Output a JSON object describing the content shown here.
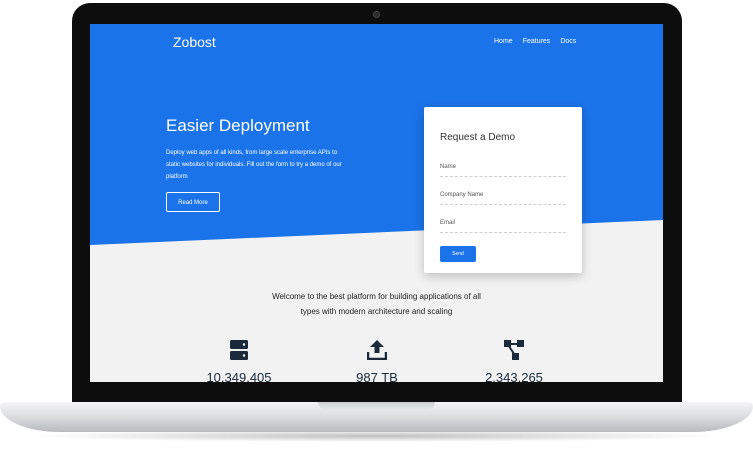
{
  "site": {
    "brand": "Zobost",
    "nav": [
      "Home",
      "Features",
      "Docs"
    ]
  },
  "hero": {
    "title": "Easier Deployment",
    "text": "Deploy web apps of all kinds, from large scale enterprise APIs to static websites for individuals. Fill out the form to try a demo of our platform",
    "button": "Read More"
  },
  "demo_form": {
    "title": "Request a Demo",
    "fields": [
      "Name",
      "Company Name",
      "Email"
    ],
    "submit": "Send"
  },
  "welcome": {
    "line1": "Welcome to the best platform for building applications of all",
    "line2": "types with modern architecture and scaling"
  },
  "stats": [
    {
      "value": "10,349,405",
      "icon": "server-icon"
    },
    {
      "value": "987 TB",
      "icon": "upload-icon"
    },
    {
      "value": "2,343,265",
      "icon": "network-icon"
    }
  ],
  "colors": {
    "primary": "#1a73e8",
    "light_bg": "#f2f2f2",
    "dark_text": "#1b2a3a"
  }
}
